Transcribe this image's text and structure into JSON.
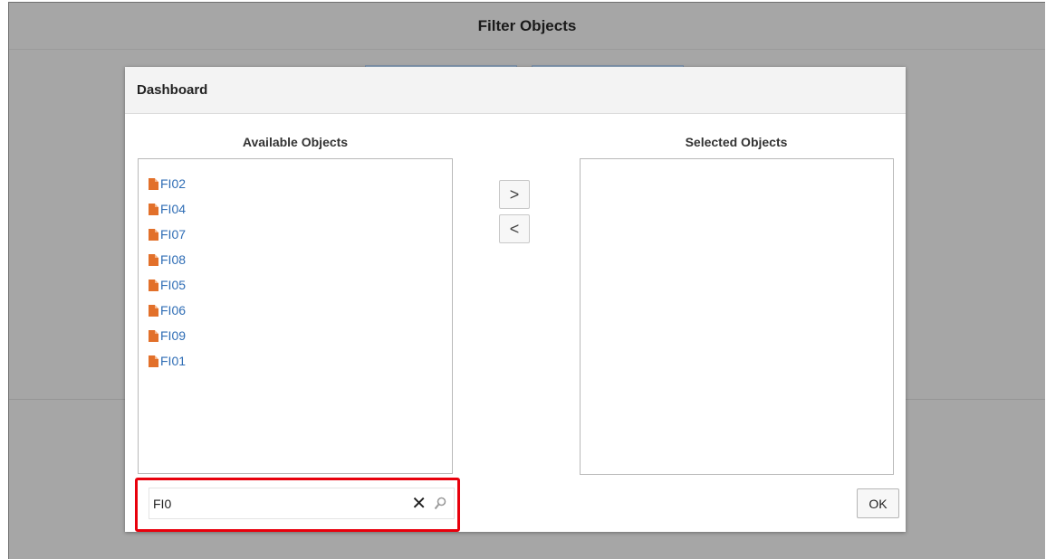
{
  "page": {
    "title": "Filter Objects"
  },
  "dialog": {
    "title": "Dashboard",
    "available_title": "Available Objects",
    "selected_title": "Selected Objects",
    "available_items": [
      {
        "label": "FI02",
        "icon": "document-icon"
      },
      {
        "label": "FI04",
        "icon": "document-icon"
      },
      {
        "label": "FI07",
        "icon": "document-icon"
      },
      {
        "label": "FI08",
        "icon": "document-icon"
      },
      {
        "label": "FI05",
        "icon": "document-icon"
      },
      {
        "label": "FI06",
        "icon": "document-icon"
      },
      {
        "label": "FI09",
        "icon": "document-icon"
      },
      {
        "label": "FI01",
        "icon": "document-icon"
      }
    ],
    "selected_items": [],
    "move_right_glyph": ">",
    "move_left_glyph": "<",
    "search": {
      "value": "FI0",
      "clear_glyph": "✕",
      "icon": "search-icon"
    },
    "ok_label": "OK"
  },
  "colors": {
    "link": "#2f6db5",
    "document_icon": "#e2702a",
    "highlight": "#e8000c",
    "overlay": "#a6a6a6"
  }
}
